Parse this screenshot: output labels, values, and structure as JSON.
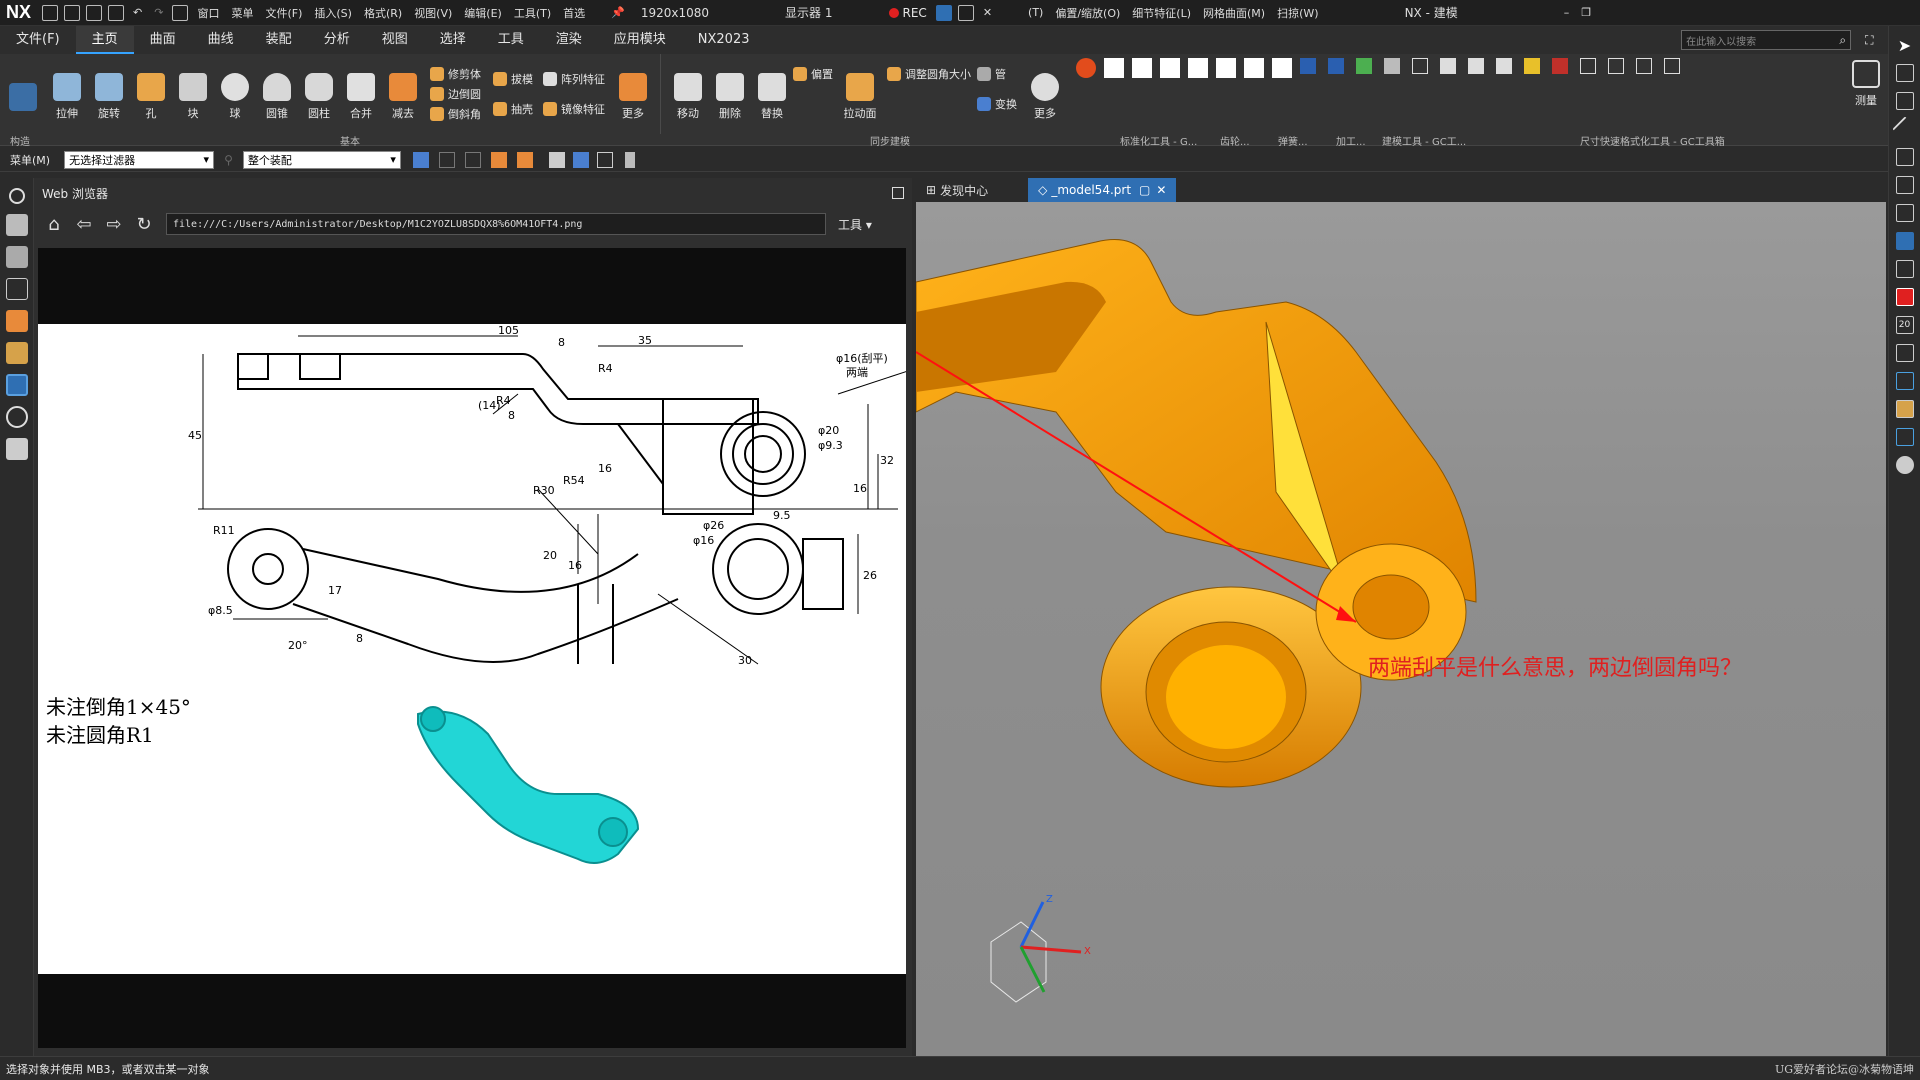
{
  "titlebar": {
    "app": "NX",
    "window_title": "NX - 建模",
    "menus": [
      "窗口",
      "菜单",
      "文件(F)",
      "插入(S)",
      "格式(R)",
      "视图(V)",
      "编辑(E)",
      "工具(T)",
      "首选"
    ],
    "resolution": "1920x1080",
    "display": "显示器 1",
    "rec": "REC",
    "right_menus": [
      "(T)",
      "偏置/缩放(O)",
      "细节特征(L)",
      "网格曲面(M)",
      "扫掠(W)"
    ]
  },
  "ribbon_tabs": [
    "文件(F)",
    "主页",
    "曲面",
    "曲线",
    "装配",
    "分析",
    "视图",
    "选择",
    "工具",
    "渲染",
    "应用模块",
    "NX2023"
  ],
  "ribbon_active_tab": "主页",
  "search_placeholder": "在此输入以搜索",
  "ribbon": {
    "basic_buttons": [
      "拉伸",
      "旋转",
      "孔",
      "块",
      "球",
      "圆锥",
      "圆柱",
      "合并",
      "减去"
    ],
    "small_buttons": [
      "修剪体",
      "边倒圆",
      "倒斜角"
    ],
    "small_buttons2": [
      "拔模",
      "抽壳"
    ],
    "small_buttons3": [
      "阵列特征",
      "镜像特征"
    ],
    "more": "更多",
    "sync_buttons": [
      "移动",
      "删除",
      "替换"
    ],
    "sync_small": [
      "偏置",
      "调整圆角大小",
      "管",
      "变换"
    ],
    "pull": "拉动面",
    "more2": "更多",
    "measure": "测量",
    "group_labels": [
      "构造",
      "基本",
      "同步建模",
      "标准化工具 - G...",
      "齿轮...",
      "弹簧...",
      "加工...",
      "建模工具 - GC工...",
      "尺寸快速格式化工具 - GC工具箱"
    ]
  },
  "filterbar": {
    "menu": "菜单(M)",
    "filter": "无选择过滤器",
    "scope": "整个装配"
  },
  "webpanel": {
    "title": "Web 浏览器",
    "url": "file:///C:/Users/Administrator/Desktop/M1C2YOZLU8SDQX8%6OM41OFT4.png",
    "tools": "工具"
  },
  "drawing": {
    "dims": [
      "105",
      "8",
      "35",
      "R4",
      "R4",
      "(14)",
      "8",
      "45",
      "16",
      "φ16(刮平)",
      "两端",
      "φ20",
      "φ9.3",
      "32",
      "16",
      "R30",
      "R54",
      "20",
      "16",
      "φ26",
      "9.5",
      "φ16",
      "R11",
      "φ8.5",
      "17",
      "20°",
      "8",
      "26",
      "30"
    ],
    "note1": "未注倒角1×45°",
    "note2": "未注圆角R1"
  },
  "viewport": {
    "tabs": [
      "发现中心",
      "_model54.prt"
    ],
    "annotation": "两端刮平是什么意思，两边倒圆角吗？",
    "axes": [
      "Z",
      "X"
    ]
  },
  "statusbar": {
    "prompt": "选择对象并使用 MB3，或者双击某一对象",
    "watermark": "UG爱好者论坛@冰菊物语坤"
  },
  "colors": {
    "part": "#f59a00",
    "accent": "#2f6fb3",
    "annotation": "#e02020"
  }
}
